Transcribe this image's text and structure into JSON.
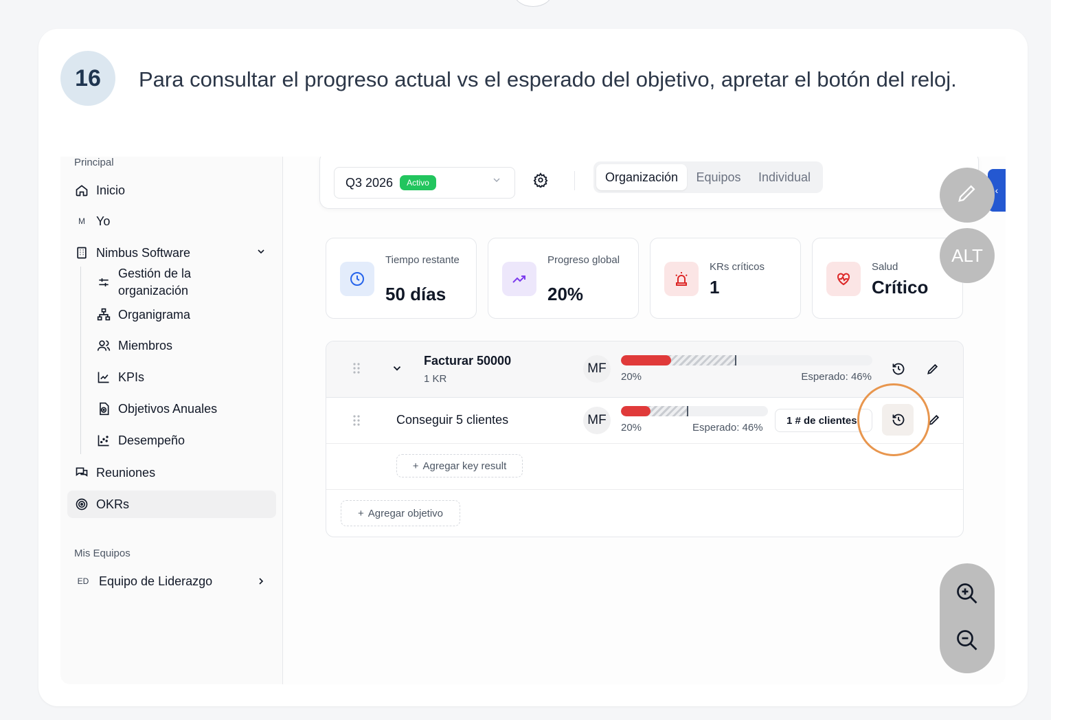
{
  "step": {
    "number": "16",
    "instruction": "Para consultar el progreso actual vs el esperado del objetivo, apretar el botón del reloj."
  },
  "sidebar": {
    "section_principal": "Principal",
    "items": [
      {
        "label": "Inicio",
        "icon": "home-icon"
      },
      {
        "label": "Yo",
        "initial": "M"
      },
      {
        "label": "Nimbus Software",
        "icon": "building-icon"
      }
    ],
    "sub_items": [
      {
        "label": "Gestión de la organización",
        "icon": "sliders-icon"
      },
      {
        "label": "Organigrama",
        "icon": "org-chart-icon"
      },
      {
        "label": "Miembros",
        "icon": "users-icon"
      },
      {
        "label": "KPIs",
        "icon": "chart-icon"
      },
      {
        "label": "Objetivos Anuales",
        "icon": "target-doc-icon"
      },
      {
        "label": "Desempeño",
        "icon": "scatter-icon"
      }
    ],
    "reuniones": "Reuniones",
    "okrs": "OKRs",
    "section_teams": "Mis Equipos",
    "team": {
      "initials": "ED",
      "label": "Equipo de Liderazgo"
    }
  },
  "toolbar": {
    "period": "Q3 2026",
    "status": "Activo",
    "tabs": [
      "Organización",
      "Equipos",
      "Individual"
    ],
    "active_tab": "Organización"
  },
  "stats": [
    {
      "label": "Tiempo restante",
      "value": "50 días",
      "icon": "clock-icon",
      "color": "#2563eb",
      "bg": "#e3ecfb"
    },
    {
      "label": "Progreso global",
      "value": "20%",
      "icon": "trend-up-icon",
      "color": "#7c3aed",
      "bg": "#ede7fb"
    },
    {
      "label": "KRs críticos",
      "value": "1",
      "icon": "siren-icon",
      "color": "#dc2626",
      "bg": "#fbe5e5"
    },
    {
      "label": "Salud",
      "value": "Crítico",
      "icon": "heart-pulse-icon",
      "color": "#dc2626",
      "bg": "#fbe5e5"
    }
  ],
  "objective": {
    "title": "Facturar 50000",
    "subtitle": "1 KR",
    "owner": "MF",
    "progress": 0.2,
    "expected": 0.46,
    "progress_label": "20%",
    "expected_label": "Esperado: 46%"
  },
  "key_result": {
    "title": "Conseguir 5 clientes",
    "owner": "MF",
    "progress": 0.2,
    "expected": 0.46,
    "progress_label": "20%",
    "expected_label": "Esperado: 46%",
    "metric": "1 # de clientes"
  },
  "actions": {
    "add_kr": "Agregar key result",
    "add_objective": "Agregar objetivo"
  },
  "overlay": {
    "alt_label": "ALT"
  },
  "colors": {
    "accent_blue": "#2458d1",
    "progress_red": "#e03a3a",
    "active_green": "#22c55e",
    "highlight_orange": "#e8964e"
  }
}
